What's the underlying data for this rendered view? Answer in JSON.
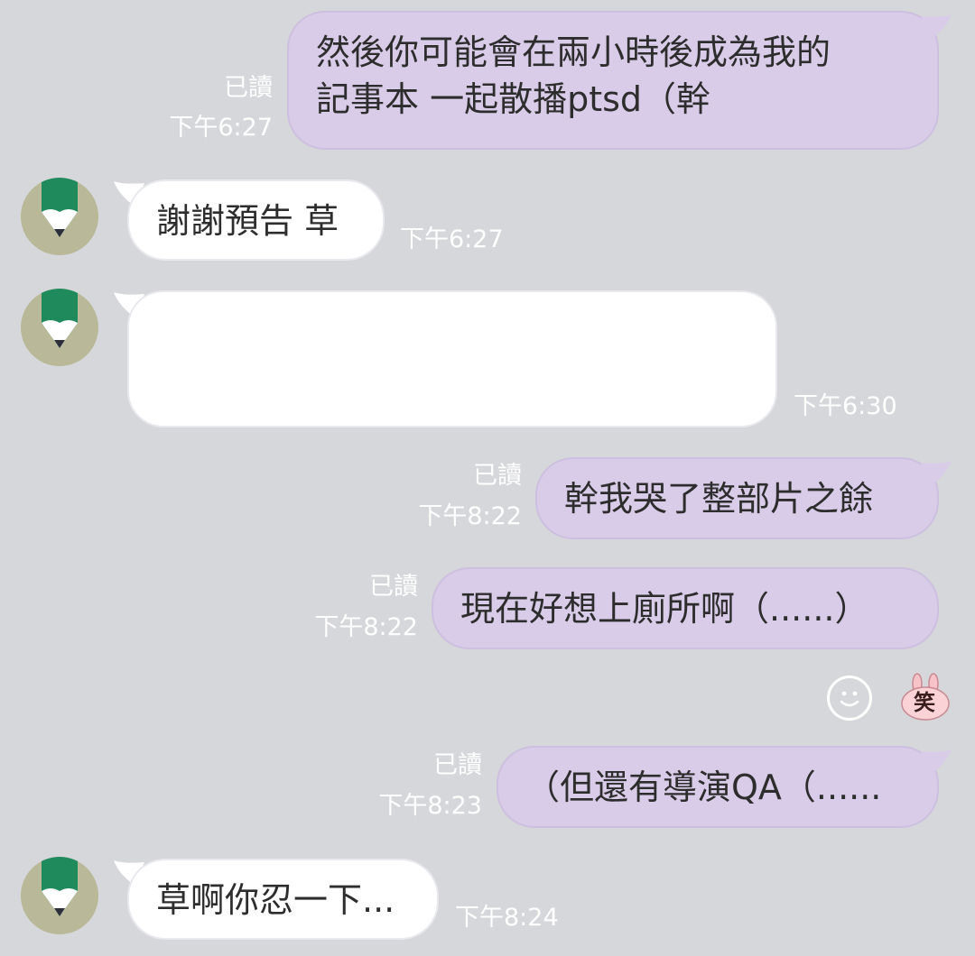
{
  "colors": {
    "background": "#d6d7da",
    "sent_bubble": "#d9cce8",
    "received_bubble": "#ffffff",
    "meta_text": "#ffffff",
    "avatar_bg": "#b9b898",
    "avatar_pencil": "#1f8a5b"
  },
  "messages": [
    {
      "id": "m1",
      "side": "sent",
      "lines": [
        "然後你可能會在兩小時後成為我的",
        "記事本 一起散播ptsd（幹"
      ],
      "read": "已讀",
      "time": "下午6:27"
    },
    {
      "id": "m2",
      "side": "received",
      "text": "謝謝預告 草",
      "time": "下午6:27",
      "avatar_icon": "pencil-avatar-icon"
    },
    {
      "id": "m3",
      "side": "received",
      "text": "",
      "time": "下午6:30",
      "avatar_icon": "pencil-avatar-icon"
    },
    {
      "id": "m4",
      "side": "sent",
      "text": "幹我哭了整部片之餘",
      "read": "已讀",
      "time": "下午8:22"
    },
    {
      "id": "m5",
      "side": "sent",
      "text": "現在好想上廁所啊（......）",
      "read": "已讀",
      "time": "下午8:22",
      "reactions": {
        "add_icon": "smiley-face-icon",
        "sticker_icon": "laughing-bunny-sticker-icon",
        "sticker_text": "笑"
      }
    },
    {
      "id": "m6",
      "side": "sent",
      "text": "（但還有導演QA（......",
      "read": "已讀",
      "time": "下午8:23"
    },
    {
      "id": "m7",
      "side": "received",
      "text": "草啊你忍一下...",
      "time": "下午8:24",
      "avatar_icon": "pencil-avatar-icon"
    }
  ]
}
